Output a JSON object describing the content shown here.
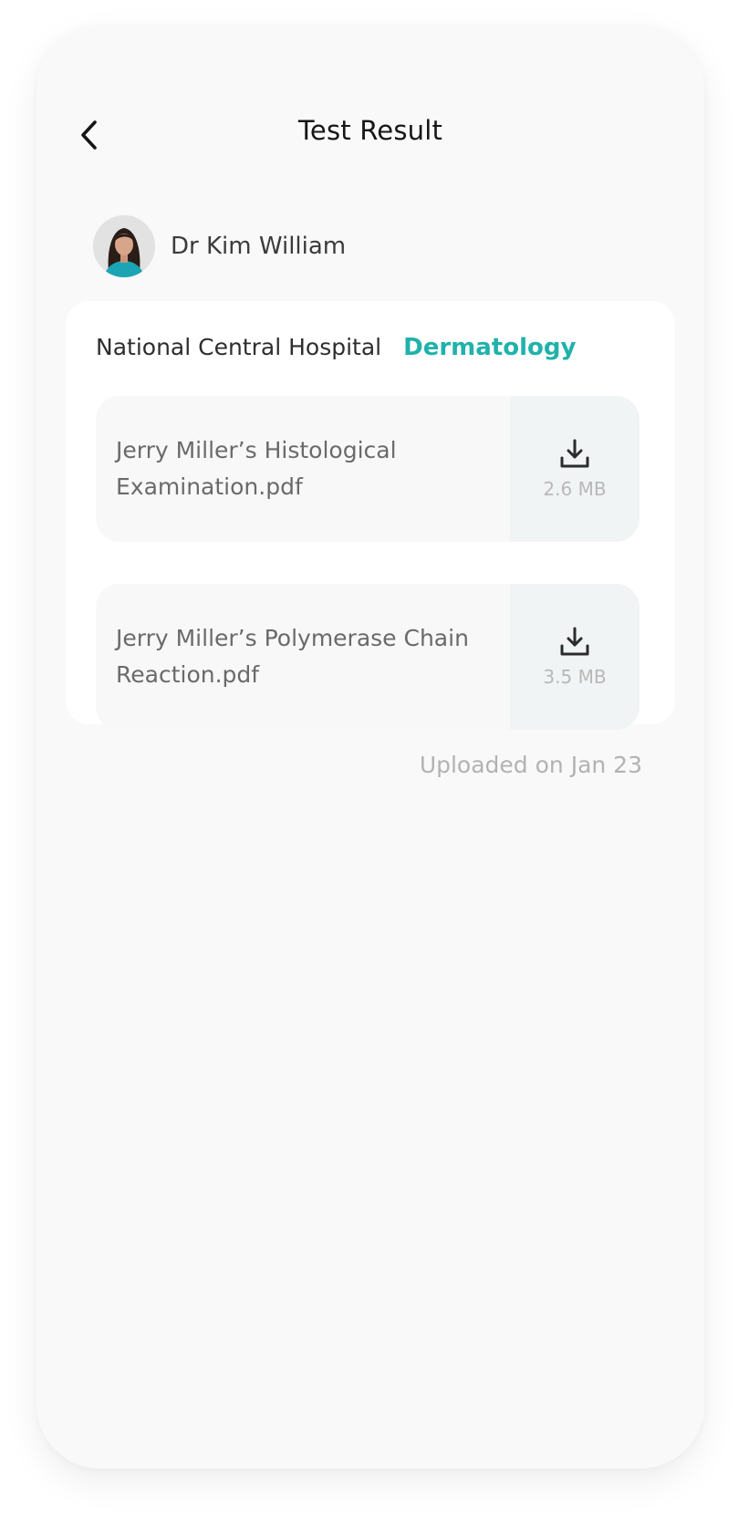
{
  "header": {
    "title": "Test Result",
    "back_icon": "chevron-left-icon"
  },
  "doctor": {
    "name": "Dr Kim William",
    "avatar": "doctor-avatar"
  },
  "record": {
    "hospital": "National Central Hospital",
    "department": "Dermatology",
    "department_color": "#20b2aa",
    "files": [
      {
        "name": "Jerry Miller’s Histological Examination.pdf",
        "size": "2.6 MB",
        "icon": "download-icon"
      },
      {
        "name": "Jerry Miller’s Polymerase Chain Reaction.pdf",
        "size": "3.5 MB",
        "icon": "download-icon"
      }
    ],
    "uploaded": "Uploaded on Jan 23"
  }
}
